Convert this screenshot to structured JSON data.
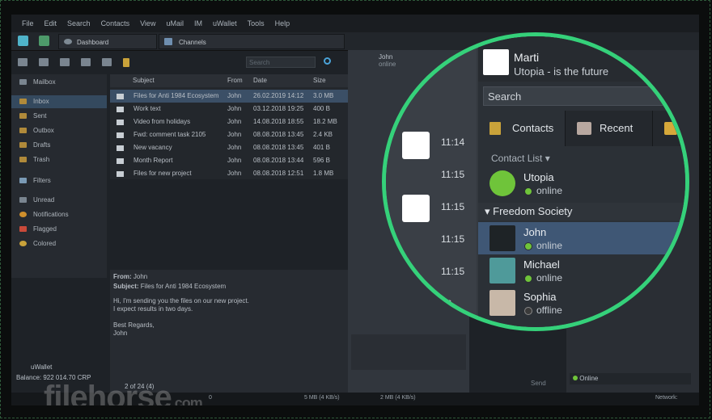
{
  "menu": [
    "File",
    "Edit",
    "Search",
    "Contacts",
    "View",
    "uMail",
    "IM",
    "uWallet",
    "Tools",
    "Help"
  ],
  "tabs": {
    "dashboard": "Dashboard",
    "channels": "Channels"
  },
  "mail_search_placeholder": "Search",
  "mailbox_label": "Mailbox",
  "folders": [
    "Inbox",
    "Sent",
    "Outbox",
    "Drafts",
    "Trash"
  ],
  "filters_label": "Filters",
  "filters": [
    "Unread",
    "Notifications",
    "Flagged",
    "Colored"
  ],
  "columns": [
    "Subject",
    "From",
    "Date",
    "Size"
  ],
  "messages": [
    {
      "subject": "Files for Anti 1984 Ecosystem",
      "from": "John",
      "date": "26.02.2019 14:12",
      "size": "3.0 MB"
    },
    {
      "subject": "Work text",
      "from": "John",
      "date": "03.12.2018 19:25",
      "size": "400 B"
    },
    {
      "subject": "Video from holidays",
      "from": "John",
      "date": "14.08.2018 18:55",
      "size": "18.2 MB"
    },
    {
      "subject": "Fwd: comment task 2105",
      "from": "John",
      "date": "08.08.2018 13:45",
      "size": "2.4 KB"
    },
    {
      "subject": "New vacancy",
      "from": "John",
      "date": "08.08.2018 13:45",
      "size": "401 B"
    },
    {
      "subject": "Month Report",
      "from": "John",
      "date": "08.08.2018 13:44",
      "size": "596 B"
    },
    {
      "subject": "Files for new project",
      "from": "John",
      "date": "08.08.2018 12:51",
      "size": "1.8 MB"
    }
  ],
  "preview": {
    "from_label": "From:",
    "from": "John",
    "subject_label": "Subject:",
    "subject": "Files for Anti 1984 Ecosystem",
    "body": [
      "Hi, I'm sending you the files on our new project.",
      "I expect results in two days.",
      "",
      "Best Regards,",
      "John"
    ]
  },
  "chat_header": {
    "name": "John",
    "status": "online"
  },
  "wallet": {
    "label": "uWallet",
    "balance": "Balance: 922 014.70 CRP"
  },
  "pager": "2 of 24 (4)",
  "bottom_status": "0",
  "transfer_up": "5 MB (4 KB/s)",
  "transfer_down": "2 MB (4 KB/s)",
  "network_label": "Network:",
  "send_label": "Send",
  "online_label": "Online",
  "profile": {
    "name": "Marti",
    "status": "Utopia - is the future"
  },
  "contact_search_placeholder": "Search",
  "contact_tabs": [
    "Contacts",
    "Recent"
  ],
  "contact_list_label": "Contact List",
  "group_name": "Freedom Society",
  "contacts": [
    {
      "name": "Utopia",
      "status": "online"
    },
    {
      "name": "John",
      "status": "online"
    },
    {
      "name": "Michael",
      "status": "online"
    },
    {
      "name": "Sophia",
      "status": "offline"
    }
  ],
  "chat_times": [
    "11:14",
    "11:15",
    "11:15",
    "11:15",
    "11:15",
    "16"
  ],
  "watermark": "filehorse",
  "watermark_tld": ".com",
  "colors": {
    "accent": "#35d17a",
    "selection": "#3f5775",
    "online": "#6fc43a",
    "offline": "#3a3a3a",
    "folder": "#b08a3a"
  }
}
